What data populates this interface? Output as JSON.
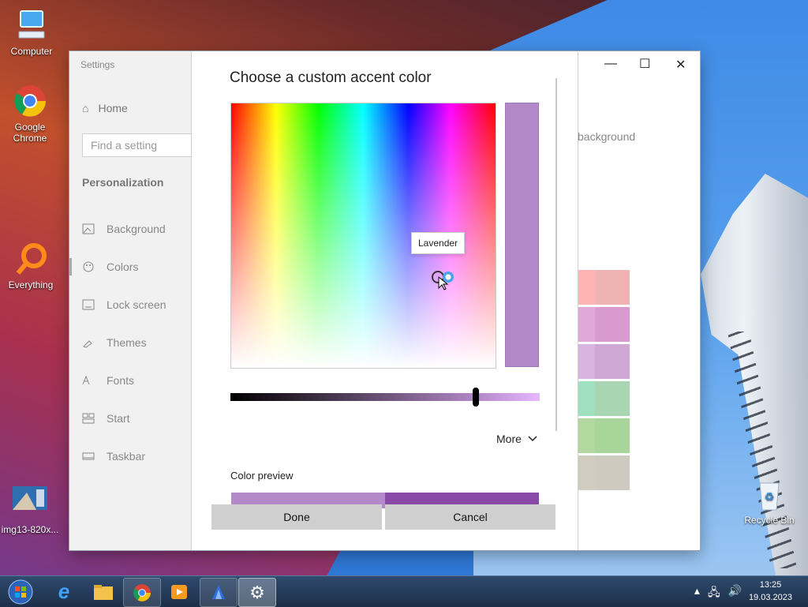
{
  "desktop": {
    "icons": [
      {
        "label": "Computer"
      },
      {
        "label": "Google Chrome"
      },
      {
        "label": "Everything"
      },
      {
        "label": "img13-820x..."
      },
      {
        "label": "Recycle Bin"
      }
    ]
  },
  "taskbar": {
    "clock_time": "13:25",
    "clock_date": "19.03.2023",
    "apps": [
      "start-orb",
      "internet-explorer",
      "file-explorer",
      "google-chrome",
      "media-player",
      "app-blue",
      "settings"
    ]
  },
  "settings": {
    "title": "Settings",
    "home": "Home",
    "search_placeholder": "Find a setting",
    "section": "Personalization",
    "nav": [
      {
        "label": "Background",
        "icon": "picture-icon"
      },
      {
        "label": "Colors",
        "icon": "palette-icon"
      },
      {
        "label": "Lock screen",
        "icon": "lock-screen-icon"
      },
      {
        "label": "Themes",
        "icon": "brush-icon"
      },
      {
        "label": "Fonts",
        "icon": "font-icon"
      },
      {
        "label": "Start",
        "icon": "start-icon"
      },
      {
        "label": "Taskbar",
        "icon": "taskbar-icon"
      }
    ],
    "background_partial": "background",
    "swatches": [
      "#ffb3b3",
      "#f0b3b3",
      "#e0a8d8",
      "#d89ad0",
      "#d8b3e0",
      "#cfa8d6",
      "#9fe0c0",
      "#a8d6b3",
      "#b3d89f",
      "#a8d69a",
      "#d0ccc0",
      "#cfcac0"
    ]
  },
  "dialog": {
    "title": "Choose a custom accent color",
    "tooltip": "Lavender",
    "more_label": "More",
    "preview_label": "Color preview",
    "done_label": "Done",
    "cancel_label": "Cancel",
    "selected_color": "#b489c9",
    "brightness_value": 0.79
  }
}
